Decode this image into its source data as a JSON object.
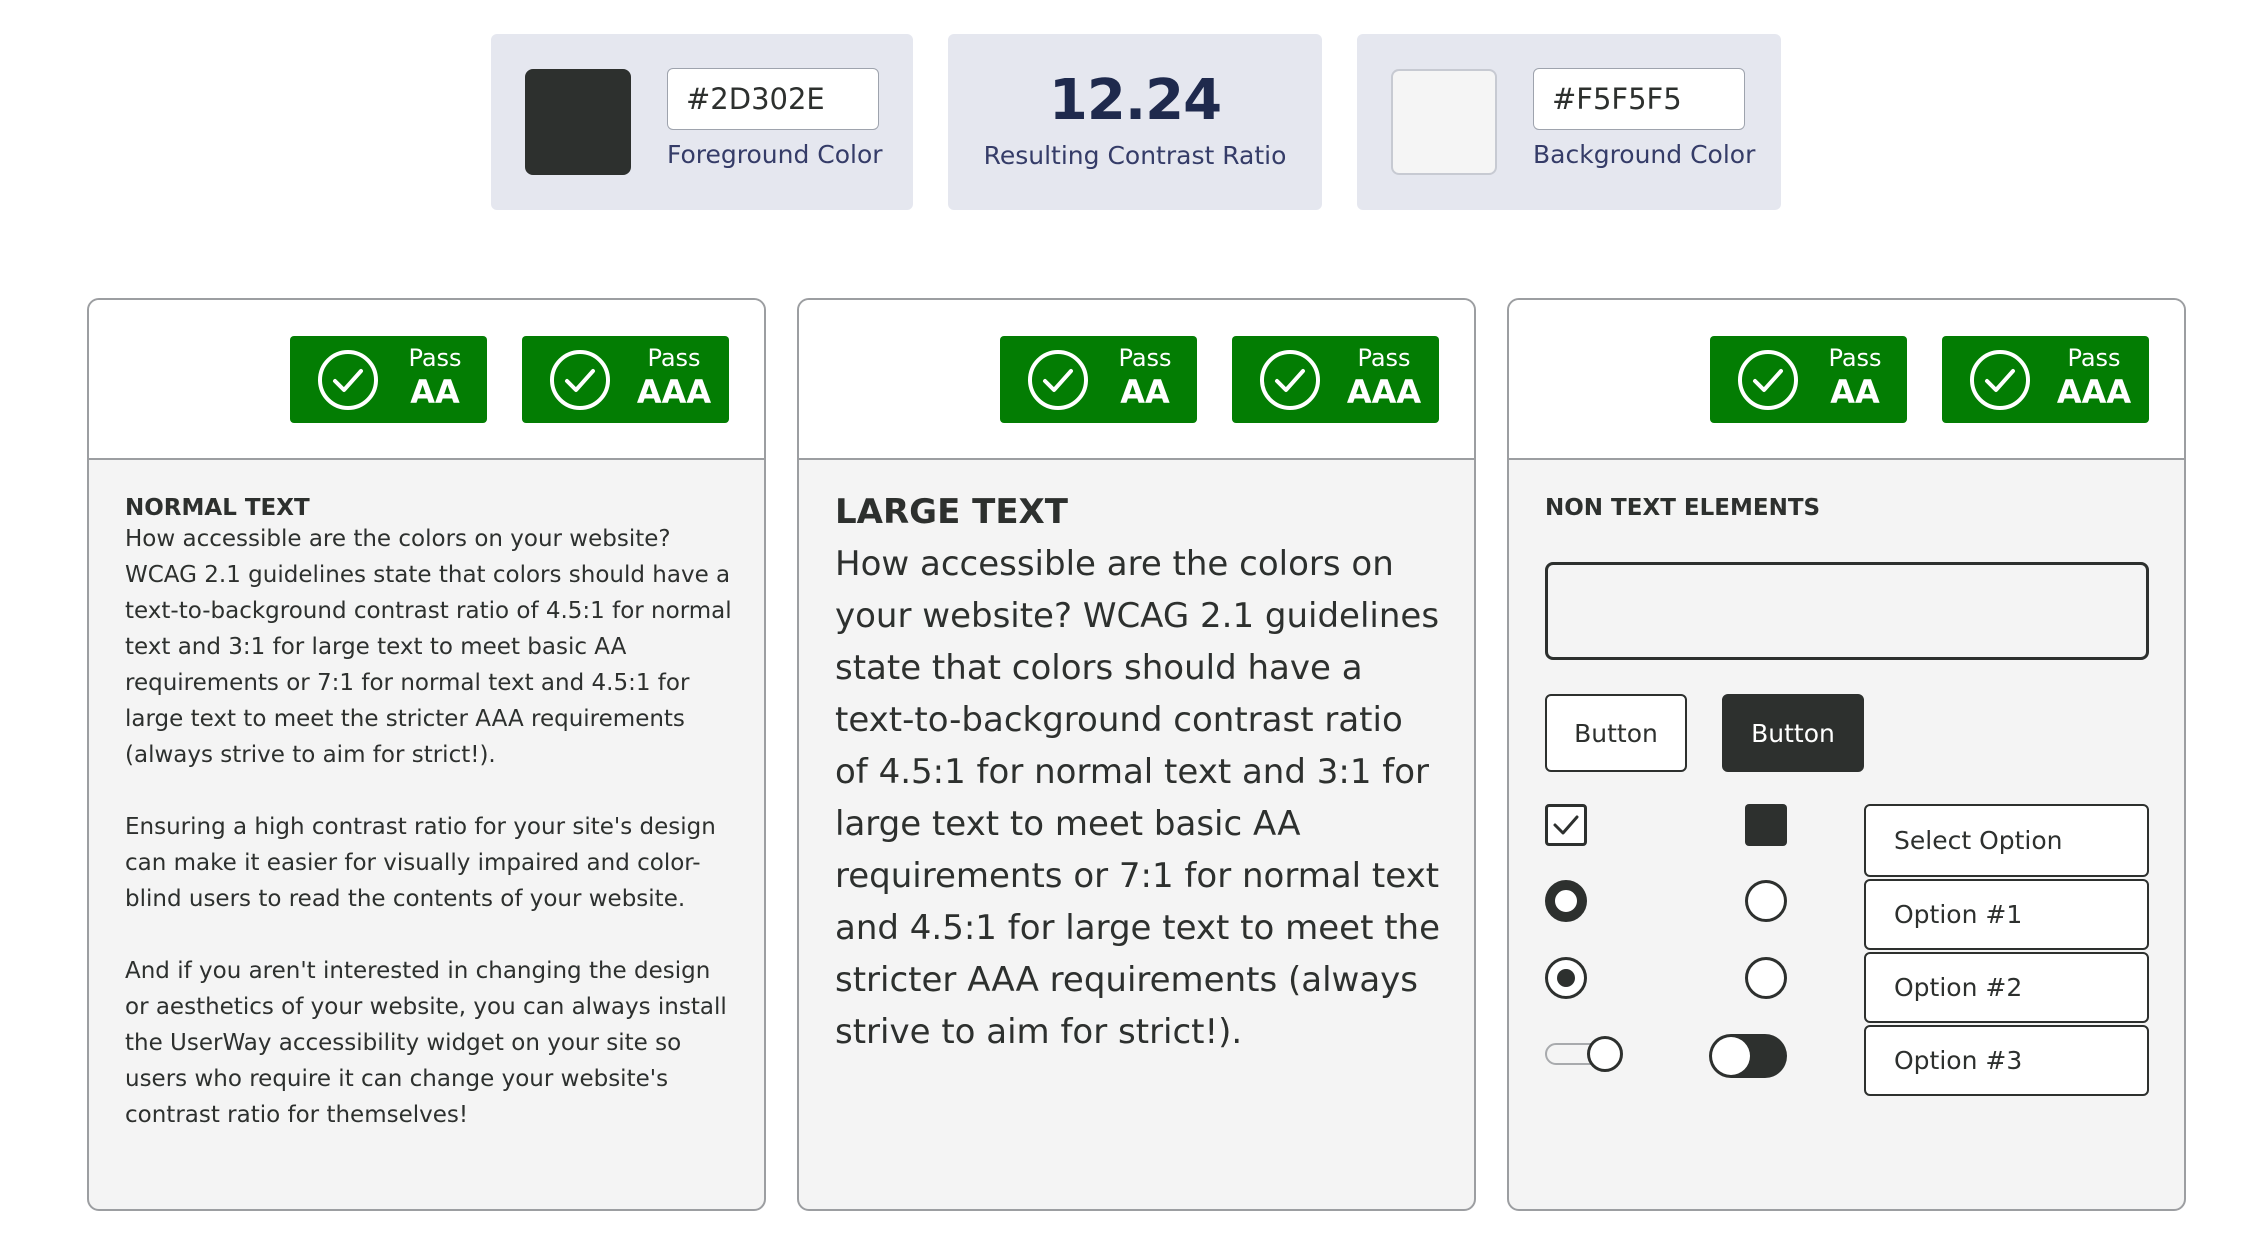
{
  "foreground": {
    "hex": "#2D302E",
    "label": "Foreground Color",
    "swatch_color": "#2d302e"
  },
  "ratio": {
    "value": "12.24",
    "label": "Resulting Contrast Ratio"
  },
  "background": {
    "hex": "#F5F5F5",
    "label": "Background Color",
    "swatch_color": "#f5f5f5"
  },
  "badges": {
    "pass": "Pass",
    "aa": "AA",
    "aaa": "AAA",
    "color": "#037d03",
    "icon": "check-circle-icon"
  },
  "normal_text": {
    "title": "NORMAL TEXT",
    "paragraphs": [
      "How accessible are the colors on your website? WCAG 2.1 guidelines state that colors should have a text-to-background contrast ratio of 4.5:1 for normal text and 3:1 for large text to meet basic AA requirements or 7:1 for normal text and 4.5:1 for large text to meet the stricter AAA requirements (always strive to aim for strict!).",
      "Ensuring a high contrast ratio for your site's design can make it easier for visually impaired and color-blind users to read the contents of your website.",
      "And if you aren't interested in changing the design or aesthetics of your website, you can always install the UserWay accessibility widget on your site so users who require it can change your website's contrast ratio for themselves!"
    ]
  },
  "large_text": {
    "title": "LARGE TEXT",
    "paragraph": "How accessible are the colors on your website? WCAG 2.1 guidelines state that colors should have a text-to-background contrast ratio of 4.5:1 for normal text and 3:1 for large text to meet basic AA requirements or 7:1 for normal text and 4.5:1 for large text to meet the stricter AAA requirements (always strive to aim for strict!)."
  },
  "non_text": {
    "title": "NON TEXT ELEMENTS",
    "input_value": "",
    "button_outline": "Button",
    "button_filled": "Button",
    "select": {
      "placeholder": "Select Option",
      "options": [
        "Option #1",
        "Option #2",
        "Option #3"
      ]
    }
  }
}
